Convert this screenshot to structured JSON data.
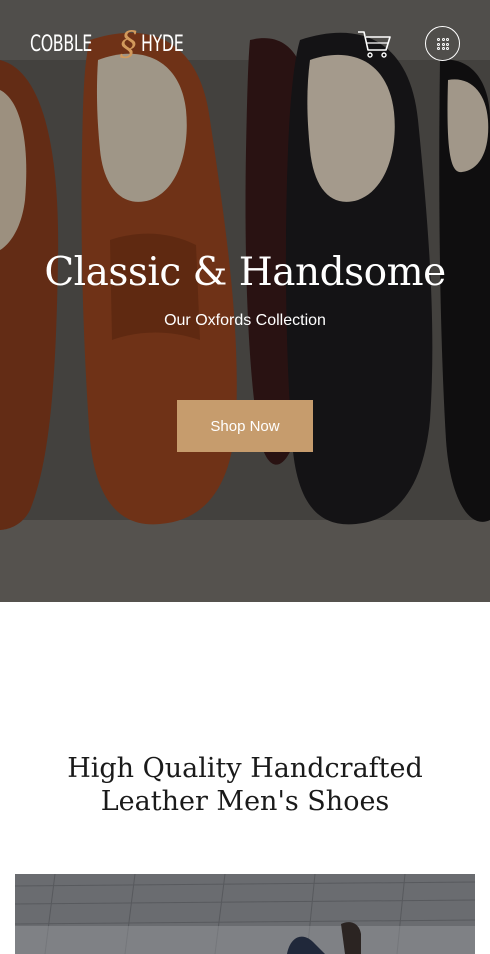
{
  "header": {
    "logo_left": "COBBLE",
    "logo_mark": "§",
    "logo_right": "HYDE",
    "cart_icon": "shopping-cart-icon",
    "menu_icon": "grid-dots-icon"
  },
  "hero": {
    "title": "Classic & Handsome",
    "subtitle": "Our Oxfords Collection",
    "cta_label": "Shop Now"
  },
  "section": {
    "title": "High Quality Handcrafted Leather Men's Shoes"
  },
  "colors": {
    "accent": "#c69c6d",
    "logo_accent": "#d29a5c",
    "text_dark": "#1a1a1a"
  }
}
